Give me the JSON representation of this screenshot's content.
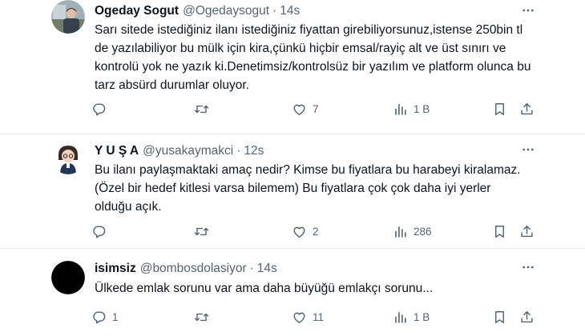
{
  "tweets": [
    {
      "name": "Ogeday Sogut",
      "handle": "@Ogedaysogut",
      "dot": "·",
      "time": "14s",
      "text": "Sarı sitede istediğiniz ilanı istediğiniz fiyattan girebiliyorsunuz,istense 250bin tl de yazılabiliyor bu mülk için kira,çünkü hiçbir emsal/rayiç alt ve üst sınırı ve kontrolü yok ne yazık ki.Denetimsiz/kontrolsüz bir yazılım ve platform olunca bu tarz  absürd durumlar oluyor.",
      "replies": "",
      "retweets": "",
      "likes": "7",
      "views": "1 B"
    },
    {
      "name": "Y U Ş A",
      "handle": "@yusakaymakci",
      "dot": "·",
      "time": "12s",
      "text": "Bu ilanı paylaşmaktaki amaç nedir? Kimse bu fiyatlara bu harabeyi kiralamaz. (Özel bir hedef kitlesi varsa bilemem) Bu fiyatlara çok çok daha iyi yerler olduğu açık.",
      "replies": "",
      "retweets": "",
      "likes": "2",
      "views": "286"
    },
    {
      "name": "isimsiz",
      "handle": "@bombosdolasiyor",
      "dot": "·",
      "time": "14s",
      "text": "Ülkede emlak sorunu var ama daha büyüğü emlakçı sorunu...",
      "replies": "1",
      "retweets": "",
      "likes": "11",
      "views": "1 B"
    }
  ],
  "icons": {
    "reply": "reply-icon",
    "retweet": "retweet-icon",
    "like": "heart-icon",
    "views": "views-icon",
    "bookmark": "bookmark-icon",
    "share": "share-icon",
    "more": "more-icon"
  },
  "colors": {
    "text": "#0f1419",
    "secondary": "#536471",
    "divider": "#e6e9ec"
  }
}
